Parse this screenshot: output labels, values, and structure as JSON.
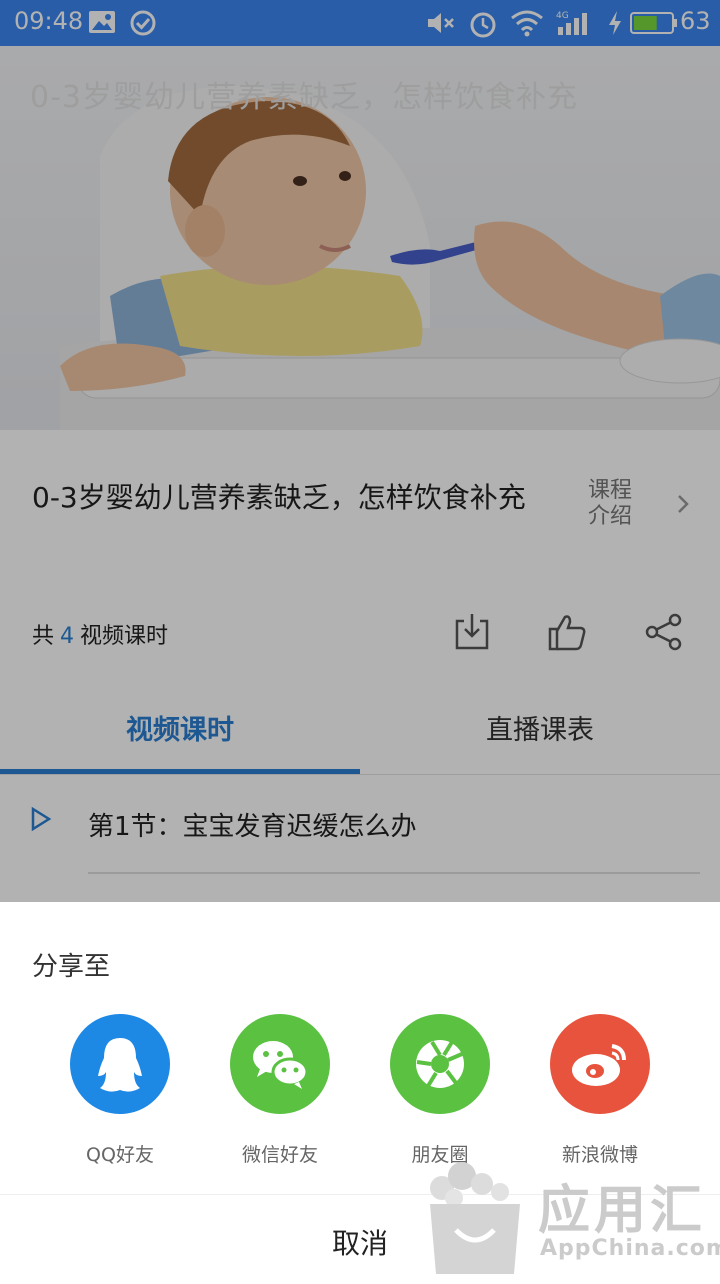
{
  "status_bar": {
    "time": "09:48",
    "network": "4G",
    "battery": "63",
    "battery_level": 0.63
  },
  "course": {
    "title": "0-3岁婴幼儿营养素缺乏，怎样饮食补充",
    "intro_label": "课程介绍",
    "hero_caption": "0-3岁婴幼儿营养素缺乏，怎样饮食补充"
  },
  "lesson_count": {
    "prefix": "共",
    "count": "4",
    "suffix": "视频课时"
  },
  "tabs": [
    {
      "label": "视频课时",
      "active": true
    },
    {
      "label": "直播课表",
      "active": false
    }
  ],
  "lessons": [
    {
      "title": "第1节：宝宝发育迟缓怎么办"
    }
  ],
  "share_sheet": {
    "title": "分享至",
    "options": [
      {
        "label": "QQ好友",
        "icon": "qq-icon",
        "color": "#1e88e5"
      },
      {
        "label": "微信好友",
        "icon": "wechat-icon",
        "color": "#5ac141"
      },
      {
        "label": "朋友圈",
        "icon": "moments-icon",
        "color": "#5ac141"
      },
      {
        "label": "新浪微博",
        "icon": "weibo-icon",
        "color": "#e8533e"
      }
    ],
    "cancel": "取消"
  },
  "watermark": {
    "name": "应用汇",
    "domain": "AppChina.com"
  },
  "colors": {
    "accent": "#2a7fd1",
    "status_bar": "#3b86ef",
    "overlay": "rgba(0,0,0,0.30)"
  }
}
